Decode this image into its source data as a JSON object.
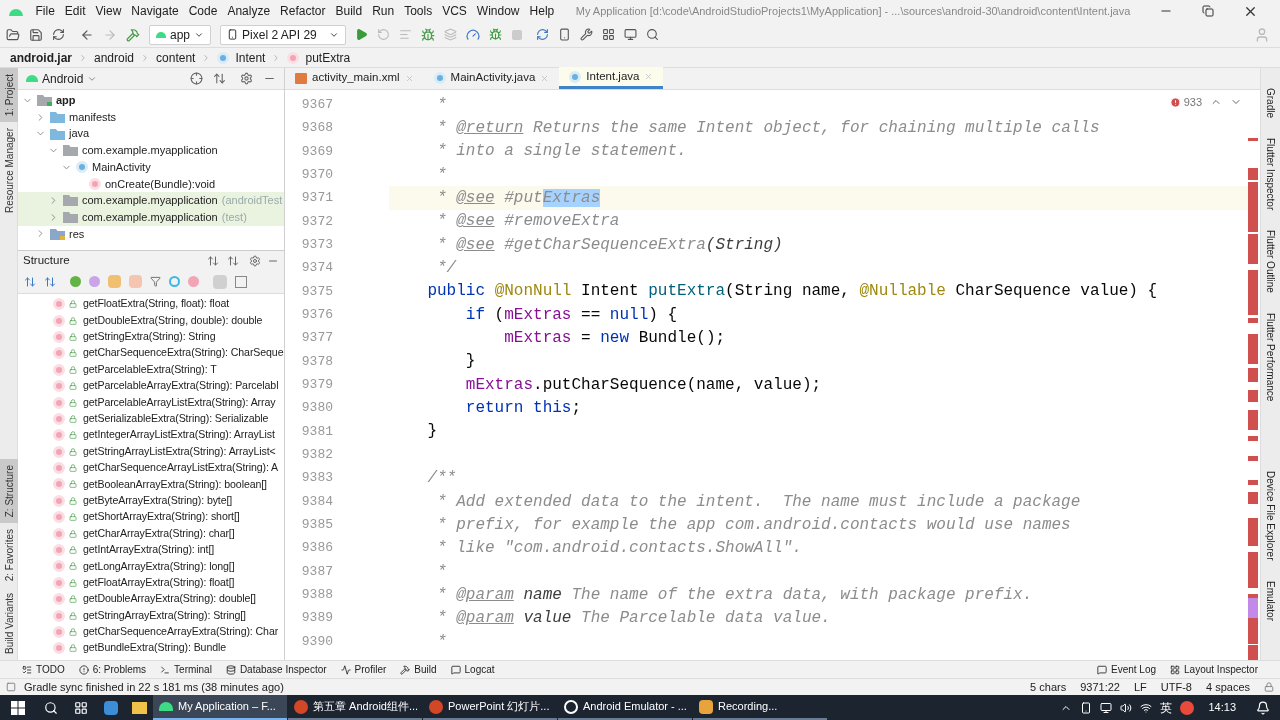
{
  "title": "My Application [d:\\code\\AndroidStudioProjects1\\MyApplication] - ...\\sources\\android-30\\android\\content\\Intent.java",
  "menu": [
    "File",
    "Edit",
    "View",
    "Navigate",
    "Code",
    "Analyze",
    "Refactor",
    "Build",
    "Run",
    "Tools",
    "VCS",
    "Window",
    "Help"
  ],
  "toolbar": {
    "run_config": "app",
    "device": "Pixel 2 API 29"
  },
  "breadcrumb": [
    {
      "label": "android.jar",
      "kind": "jar"
    },
    {
      "label": "android",
      "kind": "package"
    },
    {
      "label": "content",
      "kind": "package"
    },
    {
      "label": "Intent",
      "kind": "class"
    },
    {
      "label": "putExtra",
      "kind": "method"
    }
  ],
  "left_strip": {
    "top": [
      {
        "label": "1: Project",
        "selected": true
      },
      {
        "label": "Resource Manager",
        "selected": false
      }
    ],
    "bottom": [
      {
        "label": "Z: Structure",
        "selected": true
      },
      {
        "label": "2: Favorites",
        "selected": false
      },
      {
        "label": "Build Variants",
        "selected": false
      }
    ]
  },
  "project": {
    "view": "Android",
    "tree": [
      {
        "label": "app",
        "kind": "module",
        "expanded": true,
        "highlighted": false,
        "children": [
          {
            "label": "manifests",
            "kind": "folder",
            "expanded": false,
            "highlighted": false
          },
          {
            "label": "java",
            "kind": "folder",
            "expanded": true,
            "highlighted": false,
            "children": [
              {
                "label": "com.example.myapplication",
                "kind": "package",
                "expanded": true,
                "highlighted": false,
                "children": [
                  {
                    "label": "MainActivity",
                    "kind": "class",
                    "expanded": true,
                    "highlighted": false,
                    "children": [
                      {
                        "label": "onCreate(Bundle):void",
                        "kind": "method",
                        "highlighted": false
                      }
                    ]
                  }
                ]
              },
              {
                "label": "com.example.myapplication",
                "suffix": "(androidTest",
                "kind": "package",
                "expanded": false,
                "highlighted": true
              },
              {
                "label": "com.example.myapplication",
                "suffix": "(test)",
                "kind": "package",
                "expanded": false,
                "highlighted": true
              }
            ]
          },
          {
            "label": "res",
            "kind": "resfolder",
            "expanded": false,
            "highlighted": false
          }
        ]
      }
    ]
  },
  "structure": {
    "title": "Structure",
    "items": [
      "getFloatExtra(String, float): float",
      "getDoubleExtra(String, double): double",
      "getStringExtra(String): String",
      "getCharSequenceExtra(String): CharSeque",
      "getParcelableExtra(String): T",
      "getParcelableArrayExtra(String): Parcelabl",
      "getParcelableArrayListExtra(String): Array",
      "getSerializableExtra(String): Serializable",
      "getIntegerArrayListExtra(String): ArrayList",
      "getStringArrayListExtra(String): ArrayList<",
      "getCharSequenceArrayListExtra(String): A",
      "getBooleanArrayExtra(String): boolean[]",
      "getByteArrayExtra(String): byte[]",
      "getShortArrayExtra(String): short[]",
      "getCharArrayExtra(String): char[]",
      "getIntArrayExtra(String): int[]",
      "getLongArrayExtra(String): long[]",
      "getFloatArrayExtra(String): float[]",
      "getDoubleArrayExtra(String): double[]",
      "getStringArrayExtra(String): String[]",
      "getCharSequenceArrayExtra(String): Char",
      "getBundleExtra(String): Bundle"
    ]
  },
  "editor": {
    "tabs": [
      {
        "label": "activity_main.xml",
        "kind": "xml",
        "selected": false
      },
      {
        "label": "MainActivity.java",
        "kind": "class",
        "selected": false
      },
      {
        "label": "Intent.java",
        "kind": "class",
        "selected": true
      }
    ],
    "problems": "933",
    "lines": [
      {
        "num": "9367",
        "current": false,
        "tokens": [
          {
            "kind": "comment",
            "text": "     *"
          }
        ]
      },
      {
        "num": "9368",
        "current": false,
        "tokens": [
          {
            "kind": "comment",
            "text": "     * "
          },
          {
            "kind": "doctag",
            "text": "@return"
          },
          {
            "kind": "comment",
            "text": " Returns the same Intent object, for chaining multiple calls"
          }
        ]
      },
      {
        "num": "9369",
        "current": false,
        "tokens": [
          {
            "kind": "comment",
            "text": "     * into a single statement."
          }
        ]
      },
      {
        "num": "9370",
        "current": false,
        "tokens": [
          {
            "kind": "comment",
            "text": "     *"
          }
        ]
      },
      {
        "num": "9371",
        "current": true,
        "tokens": [
          {
            "kind": "comment",
            "text": "     * "
          },
          {
            "kind": "doctag",
            "text": "@see"
          },
          {
            "kind": "comment",
            "text": " #put"
          },
          {
            "kind": "selection",
            "text": "Extras"
          }
        ]
      },
      {
        "num": "9372",
        "current": false,
        "tokens": [
          {
            "kind": "comment",
            "text": "     * "
          },
          {
            "kind": "doctag",
            "text": "@see"
          },
          {
            "kind": "comment",
            "text": " #removeExtra"
          }
        ]
      },
      {
        "num": "9373",
        "current": false,
        "tokens": [
          {
            "kind": "comment",
            "text": "     * "
          },
          {
            "kind": "doctag",
            "text": "@see"
          },
          {
            "kind": "comment",
            "text": " #getCharSequenceExtra"
          },
          {
            "kind": "docref",
            "text": "(String)"
          }
        ]
      },
      {
        "num": "9374",
        "current": false,
        "tokens": [
          {
            "kind": "comment",
            "text": "     */"
          }
        ]
      },
      {
        "num": "9375",
        "current": false,
        "tokens": [
          {
            "kind": "keyword",
            "text": "    public "
          },
          {
            "kind": "annotation",
            "text": "@NonNull"
          },
          {
            "kind": "plain",
            "text": " Intent "
          },
          {
            "kind": "method",
            "text": "putExtra"
          },
          {
            "kind": "plain",
            "text": "(String name, "
          },
          {
            "kind": "annotation",
            "text": "@Nullable"
          },
          {
            "kind": "plain",
            "text": " CharSequence value) {"
          }
        ]
      },
      {
        "num": "9376",
        "current": false,
        "tokens": [
          {
            "kind": "keyword",
            "text": "        if"
          },
          {
            "kind": "plain",
            "text": " ("
          },
          {
            "kind": "field",
            "text": "mExtras"
          },
          {
            "kind": "plain",
            "text": " == "
          },
          {
            "kind": "keyword",
            "text": "null"
          },
          {
            "kind": "plain",
            "text": ") {"
          }
        ]
      },
      {
        "num": "9377",
        "current": false,
        "tokens": [
          {
            "kind": "field",
            "text": "            mExtras"
          },
          {
            "kind": "plain",
            "text": " = "
          },
          {
            "kind": "keyword",
            "text": "new"
          },
          {
            "kind": "plain",
            "text": " Bundle();"
          }
        ]
      },
      {
        "num": "9378",
        "current": false,
        "tokens": [
          {
            "kind": "plain",
            "text": "        }"
          }
        ]
      },
      {
        "num": "9379",
        "current": false,
        "tokens": [
          {
            "kind": "field",
            "text": "        mExtras"
          },
          {
            "kind": "plain",
            "text": ".putCharSequence(name, value);"
          }
        ]
      },
      {
        "num": "9380",
        "current": false,
        "tokens": [
          {
            "kind": "keyword",
            "text": "        return this"
          },
          {
            "kind": "plain",
            "text": ";"
          }
        ]
      },
      {
        "num": "9381",
        "current": false,
        "tokens": [
          {
            "kind": "plain",
            "text": "    }"
          }
        ]
      },
      {
        "num": "9382",
        "current": false
      },
      {
        "num": "9383",
        "current": false,
        "tokens": [
          {
            "kind": "comment",
            "text": "    /**"
          }
        ]
      },
      {
        "num": "9384",
        "current": false,
        "tokens": [
          {
            "kind": "comment",
            "text": "     * Add extended data to the intent.  The name must include a package"
          }
        ]
      },
      {
        "num": "9385",
        "current": false,
        "tokens": [
          {
            "kind": "comment",
            "text": "     * prefix, for example the app com.android.contacts would use names"
          }
        ]
      },
      {
        "num": "9386",
        "current": false,
        "tokens": [
          {
            "kind": "comment",
            "text": "     * like \"com.android.contacts.ShowAll\"."
          }
        ]
      },
      {
        "num": "9387",
        "current": false,
        "tokens": [
          {
            "kind": "comment",
            "text": "     *"
          }
        ]
      },
      {
        "num": "9388",
        "current": false,
        "tokens": [
          {
            "kind": "comment",
            "text": "     * "
          },
          {
            "kind": "doctag",
            "text": "@param"
          },
          {
            "kind": "docref",
            "text": " name"
          },
          {
            "kind": "comment",
            "text": " The name of the extra data, with package prefix."
          }
        ]
      },
      {
        "num": "9389",
        "current": false,
        "tokens": [
          {
            "kind": "comment",
            "text": "     * "
          },
          {
            "kind": "doctag",
            "text": "@param"
          },
          {
            "kind": "docref",
            "text": " value"
          },
          {
            "kind": "comment",
            "text": " The Parcelable data value."
          }
        ]
      },
      {
        "num": "9390",
        "current": false,
        "tokens": [
          {
            "kind": "comment",
            "text": "     *"
          }
        ]
      }
    ]
  },
  "right_strip": [
    "Gradle",
    "Flutter Inspector",
    "Flutter Outline",
    "Flutter Performance",
    "Device File Explorer",
    "Emulator"
  ],
  "tool_windows": {
    "left": [
      "TODO",
      "6: Problems",
      "Terminal",
      "Database Inspector",
      "Profiler",
      "Build",
      "Logcat"
    ],
    "right": [
      "Event Log",
      "Layout Inspector"
    ]
  },
  "status": {
    "message": "Gradle sync finished in 22 s 181 ms (38 minutes ago)",
    "items": [
      "5 chars",
      "9371:22",
      "LF",
      "UTF-8",
      "4 spaces"
    ]
  },
  "taskbar": {
    "apps": [
      {
        "label": "My Application – F...",
        "kind": "android",
        "selected": true
      },
      {
        "label": "第五章 Android组件...",
        "kind": "ppt",
        "selected": false
      },
      {
        "label": "PowerPoint 幻灯片...",
        "kind": "ppt",
        "selected": false
      },
      {
        "label": "Android Emulator - ...",
        "kind": "emulator",
        "selected": false
      },
      {
        "label": "Recording...",
        "kind": "recording",
        "selected": false
      }
    ],
    "ime": "英",
    "clock": "14:13"
  }
}
